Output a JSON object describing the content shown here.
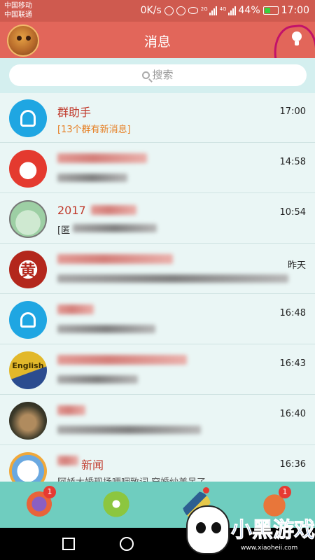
{
  "status_bar": {
    "carrier_1": "中国移动",
    "carrier_2": "中国联通",
    "net_speed": "0K/s",
    "network": "4G",
    "battery": "44%",
    "time": "17:00"
  },
  "header": {
    "title": "消息",
    "icons": [
      "avatar",
      "lightbulb-icon"
    ]
  },
  "search": {
    "placeholder": "搜索"
  },
  "conversations": [
    {
      "name": "群助手",
      "preview": "[13个群有新消息]",
      "time": "17:00",
      "avatar_icon": "group-assistant-icon"
    },
    {
      "name": "",
      "preview": "",
      "time": "14:58",
      "avatar_icon": "jd-avatar"
    },
    {
      "name": "2017",
      "preview": "[匿",
      "time": "10:54",
      "avatar_icon": "cartoon-kids-avatar"
    },
    {
      "name": "",
      "preview": "",
      "time": "昨天",
      "avatar_icon": "seal-avatar"
    },
    {
      "name": "",
      "preview": "",
      "time": "16:48",
      "avatar_icon": "bell-icon"
    },
    {
      "name": "",
      "preview": "",
      "time": "16:43",
      "avatar_icon": "english-avatar"
    },
    {
      "name": "",
      "preview": "",
      "time": "16:40",
      "avatar_icon": "handshake-avatar"
    },
    {
      "name": "新闻",
      "preview": "阿娇大婚现场哽咽致词 穿婚纱美呆了",
      "time": "16:36",
      "avatar_icon": "news-avatar"
    }
  ],
  "tabs": [
    {
      "name": "messages-tab",
      "badge": "1"
    },
    {
      "name": "contacts-tab",
      "badge": ""
    },
    {
      "name": "discover-tab",
      "badge": "dot"
    },
    {
      "name": "me-tab",
      "badge": "1"
    }
  ],
  "watermark": {
    "text": "小黑游戏",
    "url": "www.xiaoheii.com"
  },
  "colors": {
    "header": "#e2665a",
    "list_bg": "#eaf6f5",
    "tabbar": "#6fcdbf",
    "accent_name": "#c0392b",
    "group_preview": "#e67e22"
  }
}
